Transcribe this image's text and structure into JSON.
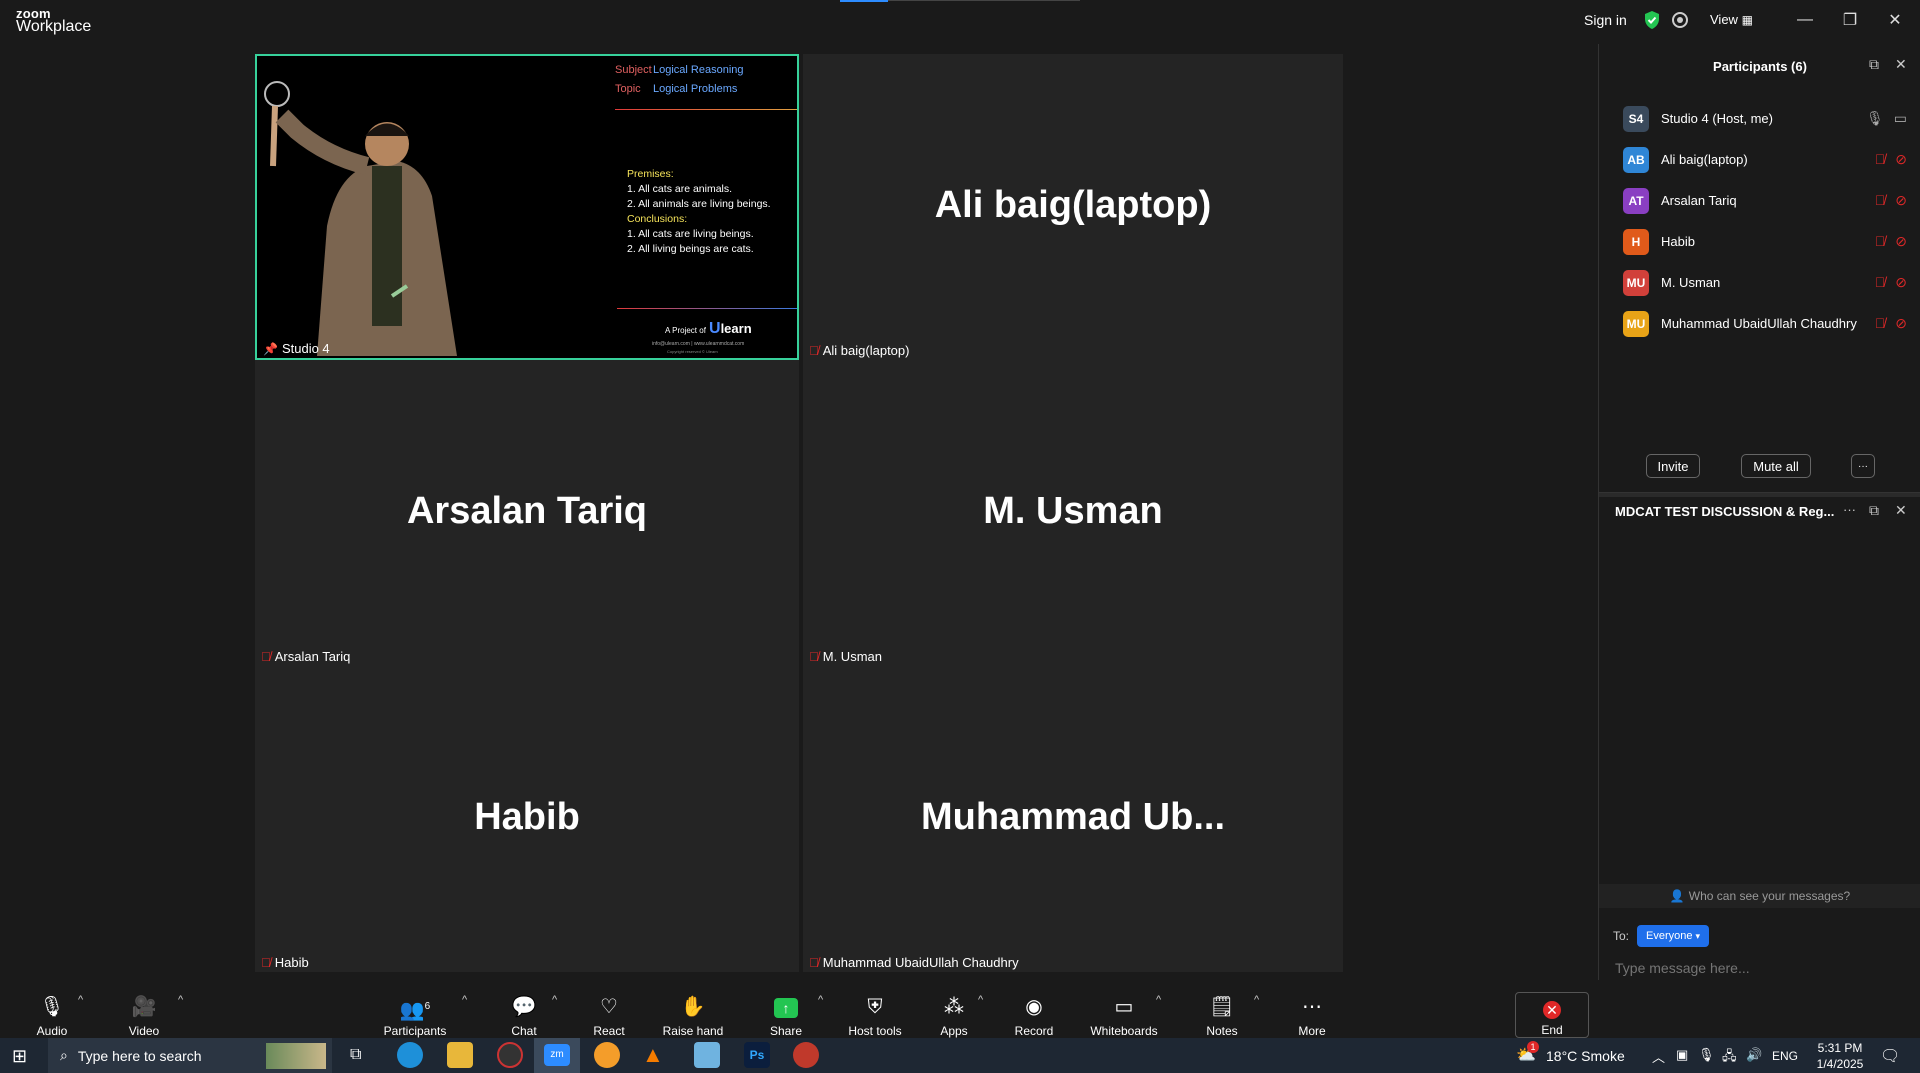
{
  "window": {
    "logo_top": "zoom",
    "logo_bottom": "Workplace",
    "sign_in": "Sign in",
    "view": "View"
  },
  "presenter": {
    "label": "Studio 4",
    "slide": {
      "subject_key": "Subject",
      "subject_val": "Logical Reasoning",
      "topic_key": "Topic",
      "topic_val": "Logical Problems",
      "premises_title": "Premises:",
      "premise1": "1.  All cats are animals.",
      "premise2": "2.  All animals are living beings.",
      "conclusions_title": "Conclusions:",
      "conclusion1": "1.  All cats are living beings.",
      "conclusion2": "2.  All living beings are cats.",
      "footer_brand": "A Project of",
      "footer_logo": "learn",
      "footer_small1": "info@ulearn.com | www.ulearnmdcat.com",
      "footer_small2": "Copyright reserved © Ulearn"
    }
  },
  "tiles": [
    {
      "name": "Ali baig(laptop)",
      "label": "Ali baig(laptop)"
    },
    {
      "name": "Arsalan Tariq",
      "label": "Arsalan Tariq"
    },
    {
      "name": "M. Usman",
      "label": "M. Usman"
    },
    {
      "name": "Habib",
      "label": "Habib"
    },
    {
      "name": "Muhammad  Ub...",
      "label": "Muhammad UbaidUllah Chaudhry"
    }
  ],
  "participants_panel": {
    "title": "Participants (6)",
    "list": [
      {
        "initials": "S4",
        "name": "Studio 4 (Host, me)",
        "color": "#3a4a5c"
      },
      {
        "initials": "AB",
        "name": "Ali baig(laptop)",
        "color": "#2f86d6"
      },
      {
        "initials": "AT",
        "name": "Arsalan Tariq",
        "color": "#8a3fc2"
      },
      {
        "initials": "H",
        "name": "Habib",
        "color": "#e05a1a"
      },
      {
        "initials": "MU",
        "name": "M. Usman",
        "color": "#d1403a"
      },
      {
        "initials": "MU",
        "name": "Muhammad UbaidUllah Chaudhry",
        "color": "#e8a317"
      }
    ],
    "invite": "Invite",
    "mute_all": "Mute all",
    "more": "···"
  },
  "chat_panel": {
    "title": "MDCAT TEST DISCUSSION & Reg...",
    "who_can_see": "Who can see your messages?",
    "to_label": "To:",
    "to_value": "Everyone",
    "placeholder": "Type message here..."
  },
  "toolbar": {
    "audio": "Audio",
    "video": "Video",
    "participants": "Participants",
    "participants_count": "6",
    "chat": "Chat",
    "react": "React",
    "raise_hand": "Raise hand",
    "share": "Share",
    "host_tools": "Host tools",
    "apps": "Apps",
    "record": "Record",
    "whiteboards": "Whiteboards",
    "notes": "Notes",
    "more": "More",
    "end": "End"
  },
  "taskbar": {
    "search_placeholder": "Type here to search",
    "weather": "18°C  Smoke",
    "lang": "ENG",
    "time": "5:31 PM",
    "date": "1/4/2025",
    "weather_badge": "1"
  }
}
